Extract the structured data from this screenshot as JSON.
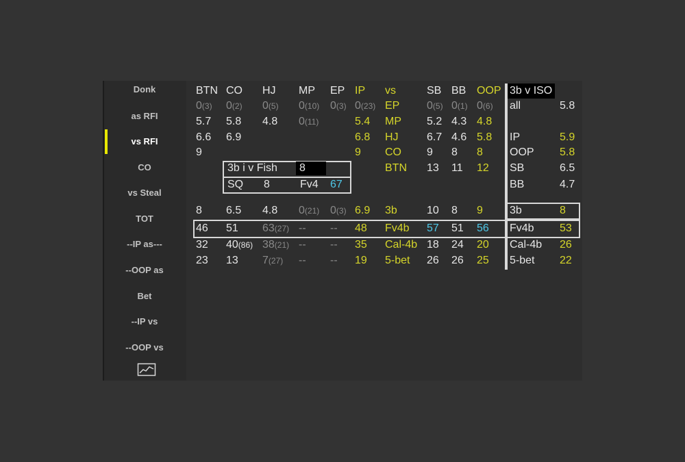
{
  "colors": {
    "background": "#333333",
    "panel": "#2e2e2e",
    "sidebar": "#2a2a2a",
    "accent_yellow": "#d6d62a",
    "accent_blue": "#4fc8e8",
    "dim_gray": "#8a8a8a",
    "active_indicator": "#e8e800"
  },
  "sidebar": {
    "items": [
      {
        "label": "Donk"
      },
      {
        "label": "as RFI"
      },
      {
        "label": "vs RFI",
        "active": true
      },
      {
        "label": "CO"
      },
      {
        "label": "vs Steal"
      },
      {
        "label": "TOT"
      },
      {
        "label": "--IP as---"
      },
      {
        "label": "--OOP as"
      },
      {
        "label": "Bet"
      },
      {
        "label": "--IP vs"
      },
      {
        "label": "--OOP vs"
      }
    ],
    "chart_button_icon": "line-chart-icon"
  },
  "headers": {
    "left": [
      "BTN",
      "CO",
      "HJ",
      "MP",
      "EP"
    ],
    "mid": [
      "IP",
      "vs"
    ],
    "right": [
      "SB",
      "BB",
      "OOP"
    ],
    "iso_title": "3b v ISO"
  },
  "rows_left": [
    [
      [
        "0",
        "(3)"
      ],
      [
        "0",
        "(2)"
      ],
      [
        "0",
        "(5)"
      ],
      [
        "0",
        "(10)"
      ],
      [
        "0",
        "(3)"
      ],
      [
        "0",
        "(23)"
      ]
    ],
    [
      [
        "5.7",
        ""
      ],
      [
        "5.8",
        ""
      ],
      [
        "4.8",
        ""
      ],
      [
        "0",
        "(11)"
      ],
      [
        "",
        ""
      ],
      [
        "5.4",
        ""
      ]
    ],
    [
      [
        "6.6",
        ""
      ],
      [
        "6.9",
        ""
      ],
      [
        "",
        ""
      ],
      [
        "",
        ""
      ],
      [
        "",
        ""
      ],
      [
        "6.8",
        ""
      ]
    ],
    [
      [
        "9",
        ""
      ],
      [
        "",
        ""
      ],
      [
        "",
        ""
      ],
      [
        "",
        ""
      ],
      [
        "",
        ""
      ],
      [
        "9",
        ""
      ]
    ]
  ],
  "vs_positions": [
    "EP",
    "MP",
    "HJ",
    "CO",
    "BTN"
  ],
  "rows_right": [
    [
      [
        "0",
        "(5)"
      ],
      [
        "0",
        "(1)"
      ],
      [
        "0",
        "(6)"
      ]
    ],
    [
      [
        "5.2",
        ""
      ],
      [
        "4.3",
        ""
      ],
      [
        "4.8",
        ""
      ]
    ],
    [
      [
        "6.7",
        ""
      ],
      [
        "4.6",
        ""
      ],
      [
        "5.8",
        ""
      ]
    ],
    [
      [
        "9",
        ""
      ],
      [
        "8",
        ""
      ],
      [
        "8",
        ""
      ]
    ],
    [
      [
        "13",
        ""
      ],
      [
        "11",
        ""
      ],
      [
        "12",
        ""
      ]
    ]
  ],
  "iso": [
    {
      "label": "all",
      "value": "5.8"
    },
    {
      "label": "",
      "value": ""
    },
    {
      "label": "IP",
      "value": "5.9"
    },
    {
      "label": "OOP",
      "value": "5.8"
    },
    {
      "label": "SB",
      "value": "6.5"
    },
    {
      "label": "BB",
      "value": "4.7"
    }
  ],
  "fish": {
    "label": "3b i v Fish",
    "value": "8",
    "sq_label": "SQ",
    "sq_value": "8",
    "fv4_label": "Fv4",
    "fv4_value": "67"
  },
  "bottom": {
    "rows": [
      {
        "cells": [
          [
            "8",
            ""
          ],
          [
            "6.5",
            ""
          ],
          [
            "4.8",
            ""
          ],
          [
            "0",
            "(21)"
          ],
          [
            "0",
            "(3)"
          ],
          [
            "6.9",
            ""
          ]
        ],
        "label": "3b",
        "right": [
          [
            "10",
            ""
          ],
          [
            "8",
            ""
          ],
          [
            "9",
            ""
          ]
        ],
        "side_label": "3b",
        "side_value": "8"
      },
      {
        "cells": [
          [
            "46",
            ""
          ],
          [
            "51",
            ""
          ],
          [
            "63",
            "(27)"
          ],
          [
            "--",
            ""
          ],
          [
            "--",
            ""
          ],
          [
            "48",
            ""
          ]
        ],
        "label": "Fv4b",
        "right": [
          [
            "57",
            ""
          ],
          [
            "51",
            ""
          ],
          [
            "56",
            ""
          ]
        ],
        "side_label": "Fv4b",
        "side_value": "53"
      },
      {
        "cells": [
          [
            "32",
            ""
          ],
          [
            "40",
            "(86)"
          ],
          [
            "38",
            "(21)"
          ],
          [
            "--",
            ""
          ],
          [
            "--",
            ""
          ],
          [
            "35",
            ""
          ]
        ],
        "label": "Cal-4b",
        "right": [
          [
            "18",
            ""
          ],
          [
            "24",
            ""
          ],
          [
            "20",
            ""
          ]
        ],
        "side_label": "Cal-4b",
        "side_value": "26"
      },
      {
        "cells": [
          [
            "23",
            ""
          ],
          [
            "13",
            ""
          ],
          [
            "7",
            "(27)"
          ],
          [
            "--",
            ""
          ],
          [
            "--",
            ""
          ],
          [
            "19",
            ""
          ]
        ],
        "label": "5-bet",
        "right": [
          [
            "26",
            ""
          ],
          [
            "26",
            ""
          ],
          [
            "25",
            ""
          ]
        ],
        "side_label": "5-bet",
        "side_value": "22"
      }
    ]
  }
}
